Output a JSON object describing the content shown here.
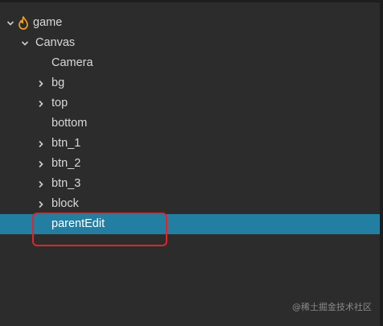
{
  "tree": {
    "root": {
      "label": "game",
      "icon": "flame-icon",
      "expanded": true
    },
    "canvas": {
      "label": "Canvas",
      "expanded": true
    },
    "children": [
      {
        "label": "Camera",
        "has_children": false
      },
      {
        "label": "bg",
        "has_children": true
      },
      {
        "label": "top",
        "has_children": true
      },
      {
        "label": "bottom",
        "has_children": false
      },
      {
        "label": "btn_1",
        "has_children": true
      },
      {
        "label": "btn_2",
        "has_children": true
      },
      {
        "label": "btn_3",
        "has_children": true
      },
      {
        "label": "block",
        "has_children": true
      },
      {
        "label": "parentEdit",
        "has_children": false,
        "selected": true
      }
    ]
  },
  "annotation": {
    "color": "#e0242b",
    "target": "parentEdit"
  },
  "watermark": "@稀土掘金技术社区",
  "colors": {
    "background": "#2c2c2c",
    "selection": "#237fa1",
    "text": "#d8d8d8",
    "flame": "#f0a020"
  }
}
